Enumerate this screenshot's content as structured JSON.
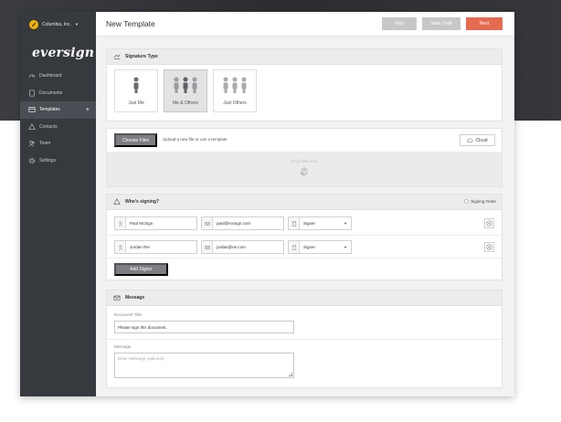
{
  "org": {
    "name": "Columbia, Inc."
  },
  "brand": "eversign",
  "sidebar": {
    "items": [
      {
        "label": "Dashboard",
        "icon": "dashboard-icon"
      },
      {
        "label": "Documents",
        "icon": "documents-icon"
      },
      {
        "label": "Templates",
        "icon": "templates-icon",
        "active": true
      },
      {
        "label": "Contacts",
        "icon": "contacts-icon"
      },
      {
        "label": "Team",
        "icon": "team-icon"
      },
      {
        "label": "Settings",
        "icon": "settings-icon"
      }
    ]
  },
  "header": {
    "title": "New Template",
    "help_label": "Help",
    "save_draft_label": "Save Draft",
    "next_label": "Next"
  },
  "signature_type": {
    "title": "Signature Type",
    "options": [
      {
        "label": "Just Me",
        "selected": false
      },
      {
        "label": "Me & Others",
        "selected": true
      },
      {
        "label": "Just Others",
        "selected": false
      }
    ]
  },
  "upload": {
    "choose_label": "Choose Files",
    "hint": "Upload a new file or use a template",
    "cloud_label": "Cloud",
    "drop_text": "Drop files here"
  },
  "signers": {
    "title": "Who's signing?",
    "signing_order_label": "Signing Order",
    "rows": [
      {
        "name": "Paul McSign",
        "email": "paul@mcsign.com",
        "role": "Signer"
      },
      {
        "name": "Jordan Rei",
        "email": "jordan@rei.com",
        "role": "Signer"
      }
    ],
    "add_label": "Add Signer"
  },
  "message": {
    "title": "Message",
    "doc_title_label": "Document Title",
    "doc_title_value": "Please sign this document.",
    "message_label": "Message",
    "message_placeholder": "Enter Message (optional)"
  },
  "colors": {
    "sidebar": "#36393e",
    "accent": "#e46a50",
    "muted_button": "#c6c7c9",
    "dark_button": "#7c7e83"
  }
}
